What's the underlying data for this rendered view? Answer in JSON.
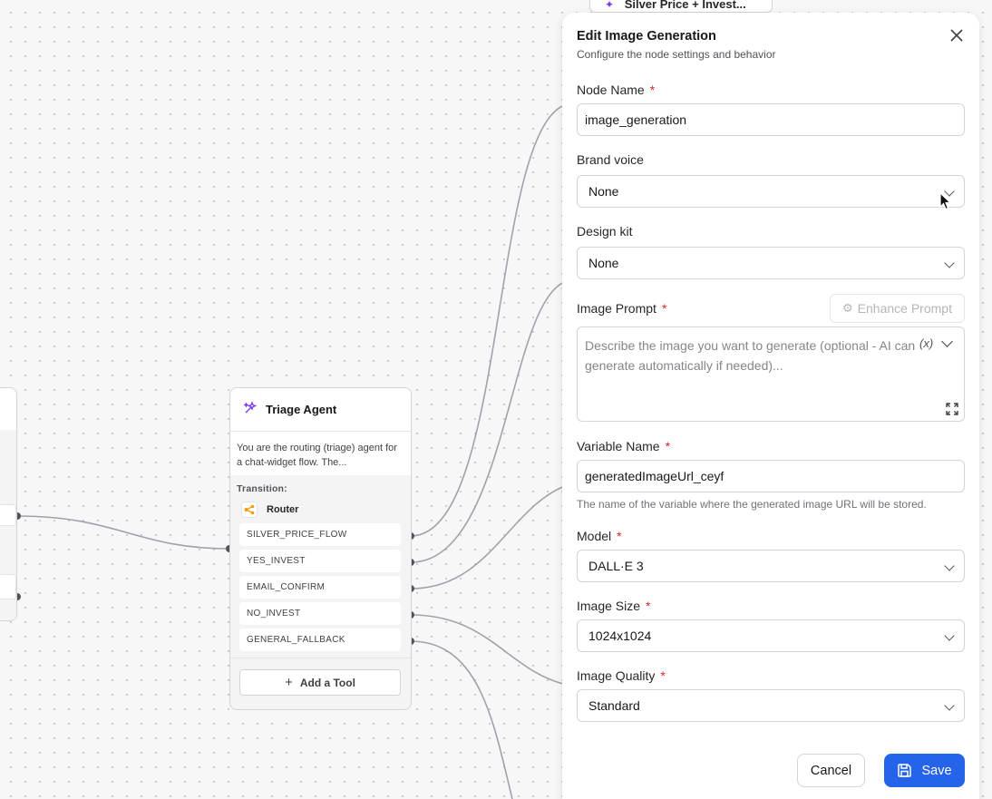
{
  "colors": {
    "accent": "#2563eb",
    "required": "#dc2626",
    "agent_icon": "#7c3aed",
    "router_icon": "#f59e0b"
  },
  "canvas": {
    "top_node": {
      "title": "Silver Price + Invest...",
      "icon": "sparkle-icon"
    },
    "triage_node": {
      "title": "Triage Agent",
      "icon": "sparkle-icon",
      "description": "You are the routing (triage) agent for a chat-widget flow. The...",
      "transition_label": "Transition:",
      "router_label": "Router",
      "routes": [
        "SILVER_PRICE_FLOW",
        "YES_INVEST",
        "EMAIL_CONFIRM",
        "NO_INVEST",
        "GENERAL_FALLBACK"
      ],
      "add_tool_label": "Add a Tool"
    }
  },
  "panel": {
    "title": "Edit Image Generation",
    "subtitle": "Configure the node settings and behavior",
    "required_mark": "*",
    "node_name": {
      "label": "Node Name",
      "value": "image_generation"
    },
    "brand_voice": {
      "label": "Brand voice",
      "value": "None"
    },
    "design_kit": {
      "label": "Design kit",
      "value": "None"
    },
    "image_prompt": {
      "label": "Image Prompt",
      "enhance_label": "Enhance Prompt",
      "placeholder": "Describe the image you want to generate (optional - AI can generate automatically if needed)...",
      "variable_symbol": "(x)"
    },
    "variable_name": {
      "label": "Variable Name",
      "value": "generatedImageUrl_ceyf",
      "helper": "The name of the variable where the generated image URL will be stored."
    },
    "model": {
      "label": "Model",
      "value": "DALL·E 3"
    },
    "image_size": {
      "label": "Image Size",
      "value": "1024x1024"
    },
    "image_quality": {
      "label": "Image Quality",
      "value": "Standard"
    },
    "cancel_label": "Cancel",
    "save_label": "Save"
  }
}
